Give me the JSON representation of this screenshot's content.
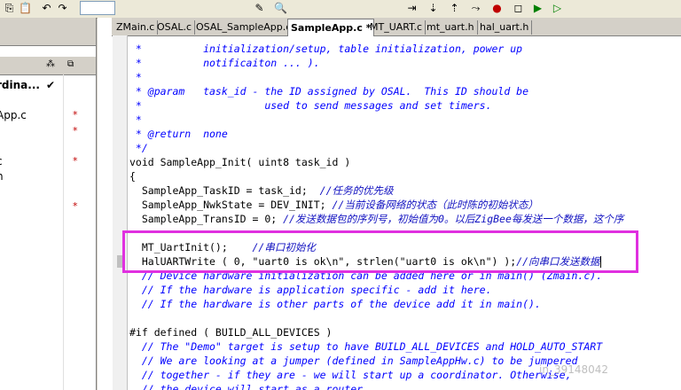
{
  "toolbar": {
    "icons": [
      "copy-icon",
      "paste-icon",
      "undo-icon",
      "redo-icon",
      "dropdown-icon",
      "edit-icon",
      "find-icon",
      "step-icon",
      "step-into-icon",
      "step-out-icon",
      "run-to-icon",
      "breakpoint-icon",
      "stop-icon",
      "go-icon",
      "debug-icon"
    ]
  },
  "workspace": {
    "header_icons": [
      "file-type-icon",
      "build-icon"
    ],
    "rows": [
      {
        "name": "rdina...",
        "bold": true,
        "check": "✔",
        "star": ""
      },
      {
        "name": "App.c",
        "bold": false,
        "check": "",
        "star": "*"
      },
      {
        "name": "",
        "bold": false,
        "check": "",
        "star": "*"
      },
      {
        "name": "c",
        "bold": false,
        "check": "",
        "star": "*"
      },
      {
        "name": "h",
        "bold": false,
        "check": "",
        "star": ""
      },
      {
        "name": "",
        "bold": false,
        "check": "",
        "star": "*"
      }
    ]
  },
  "tabs": [
    {
      "label": "ZMain.c",
      "active": false
    },
    {
      "label": "OSAL.c",
      "active": false
    },
    {
      "label": "OSAL_SampleApp.c",
      "active": false
    },
    {
      "label": "SampleApp.c *",
      "active": true
    },
    {
      "label": "MT_UART.c",
      "active": false
    },
    {
      "label": "mt_uart.h",
      "active": false
    },
    {
      "label": "hal_uart.h",
      "active": false
    }
  ],
  "code": {
    "l1": " *          initialization/setup, table initialization, power up",
    "l2": " *          notificaiton ... ).",
    "l3": " *",
    "l4": " * @param   task_id - the ID assigned by OSAL.  This ID should be",
    "l5": " *                    used to send messages and set timers.",
    "l6": " *",
    "l7": " * @return  none",
    "l8": " */",
    "l9": "void SampleApp_Init( uint8 task_id )",
    "l10": "{",
    "l11a": "  SampleApp_TaskID = task_id;  ",
    "l11b": "//任务的优先级",
    "l12a": "  SampleApp_NwkState = DEV_INIT; ",
    "l12b": "//当前设备网络的状态（此时陈的初始状态）",
    "l13a": "  SampleApp_TransID = 0; ",
    "l13b": "//发送数据包的序列号，初始值为0。以后ZigBee每发送一个数据，这个序",
    "l14": "",
    "l15a": "  MT_UartInit();    ",
    "l15b": "//串口初始化",
    "l16a": "  HalUARTWrite ( 0, \"uart0 is ok\\n\", strlen(\"uart0 is ok\\n\") );",
    "l16b": "//向串口发送数据",
    "l17": "  // Device hardware initialization can be added here or in main() (Zmain.c).",
    "l18": "  // If the hardware is application specific - add it here.",
    "l19": "  // If the hardware is other parts of the device add it in main().",
    "l20": "",
    "l21": "#if defined ( BUILD_ALL_DEVICES )",
    "l22": "  // The \"Demo\" target is setup to have BUILD_ALL_DEVICES and HOLD_AUTO_START",
    "l23": "  // We are looking at a jumper (defined in SampleAppHw.c) to be jumpered",
    "l24": "  // together - if they are - we will start up a coordinator. Otherwise,",
    "l25": "  // the device will start as a router."
  },
  "watermark": "in_39148042",
  "colors": {
    "highlight": "#e030e0",
    "comment": "#0000ff"
  }
}
